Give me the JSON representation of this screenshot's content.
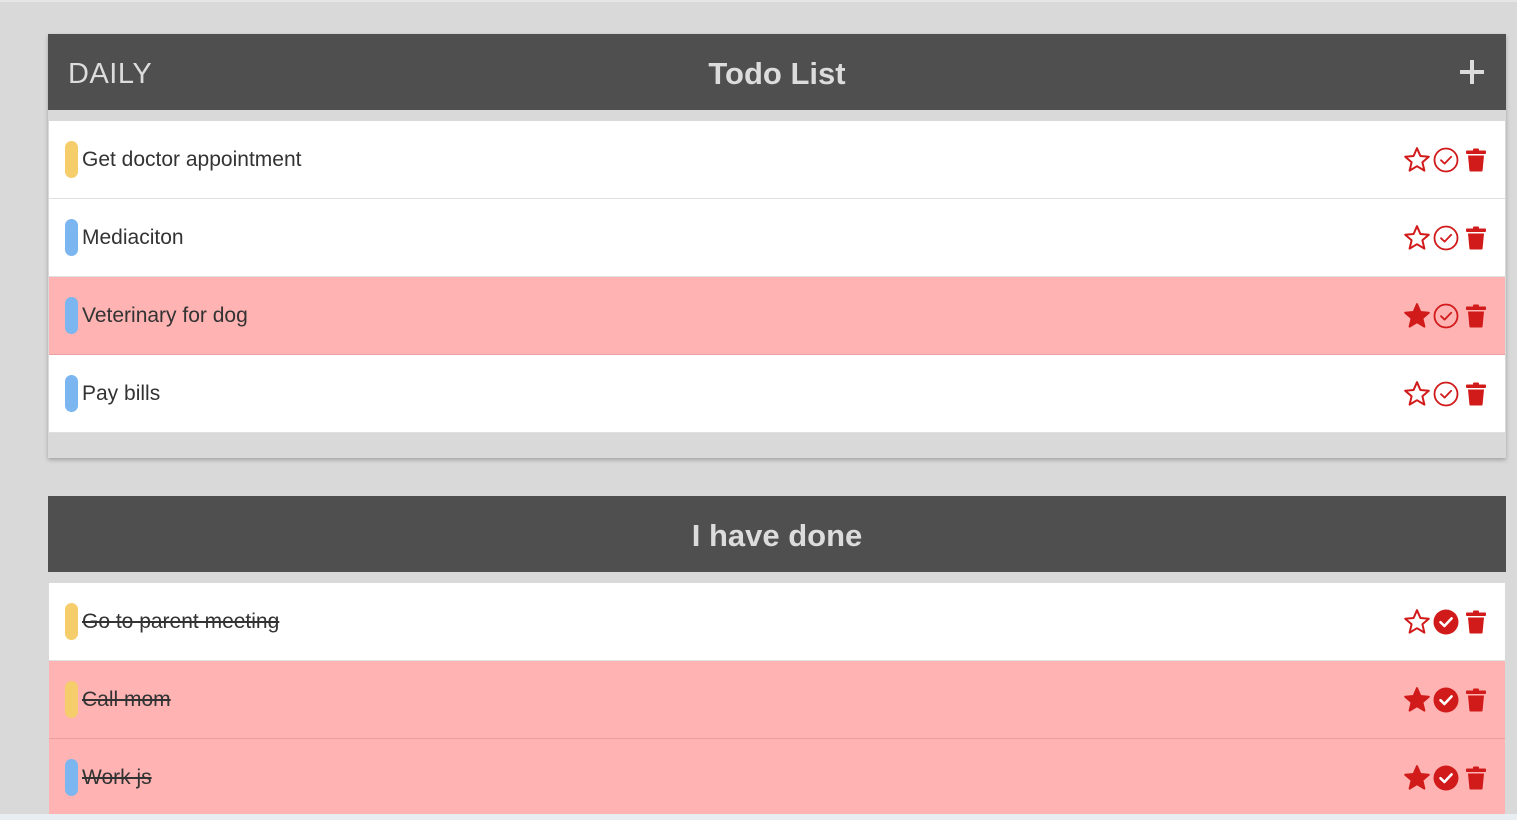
{
  "colors": {
    "header_bg": "#4f4f4f",
    "header_text": "#dcdcdc",
    "starred_row_bg": "#ffb3b3",
    "icon_red": "#d11a1a",
    "tag_yellow": "#f5cd6a",
    "tag_blue": "#7bb6f0"
  },
  "todo": {
    "category": "DAILY",
    "title": "Todo List",
    "add_icon": "plus-icon",
    "items": [
      {
        "label": "Get doctor appointment",
        "tag_color": "#f5cd6a",
        "starred": false,
        "done": false
      },
      {
        "label": "Mediaciton",
        "tag_color": "#7bb6f0",
        "starred": false,
        "done": false
      },
      {
        "label": "Veterinary for dog",
        "tag_color": "#7bb6f0",
        "starred": true,
        "done": false
      },
      {
        "label": "Pay bills",
        "tag_color": "#7bb6f0",
        "starred": false,
        "done": false
      }
    ]
  },
  "done": {
    "title": "I have done",
    "items": [
      {
        "label": "Go to parent meeting",
        "tag_color": "#f5cd6a",
        "starred": false,
        "done": true
      },
      {
        "label": "Call mom",
        "tag_color": "#f5cd6a",
        "starred": true,
        "done": true
      },
      {
        "label": "Work js",
        "tag_color": "#7bb6f0",
        "starred": true,
        "done": true
      }
    ]
  },
  "icons": {
    "star": "star-icon",
    "check": "check-circle-icon",
    "trash": "trash-icon"
  }
}
